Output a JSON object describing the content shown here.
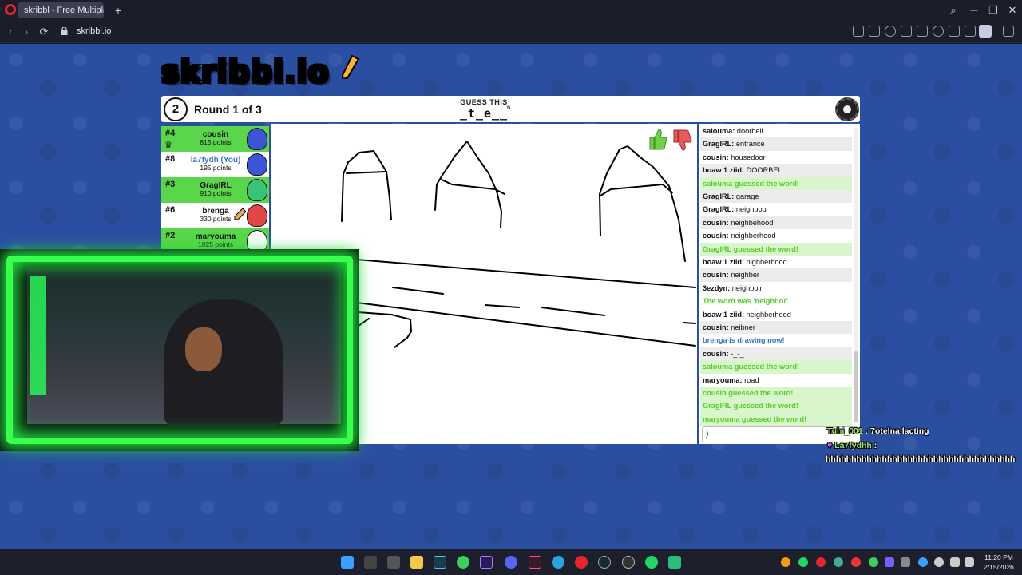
{
  "browser": {
    "tab_title": "skribbl - Free Multiplayer",
    "url": "skribbl.io",
    "new_tab": "+",
    "win_min": "─",
    "win_max": "❐",
    "win_close": "✕",
    "search_icon": "⌕",
    "back": "‹",
    "forward": "›",
    "reload": "⟳"
  },
  "game": {
    "logo": "skribbl.io",
    "round_number": "2",
    "round_text": "Round 1 of 3",
    "guess_label": "GUESS THIS",
    "hint": "_t_e__",
    "hint_count": "6"
  },
  "players": [
    {
      "rank": "#4",
      "name": "cousin",
      "points": "815 points",
      "bg": "#59d64a",
      "avatar_color": "#3b55d6",
      "crown": true
    },
    {
      "rank": "#8",
      "name": "la7fydh (You)",
      "points": "195 points",
      "bg": "#ffffff",
      "avatar_color": "#3b55d6",
      "you": true
    },
    {
      "rank": "#3",
      "name": "GragIRL",
      "points": "910 points",
      "bg": "#59d64a",
      "avatar_color": "#39c27a"
    },
    {
      "rank": "#6",
      "name": "brenga",
      "points": "330 points",
      "bg": "#ffffff",
      "avatar_color": "#e04646",
      "drawing": true
    },
    {
      "rank": "#2",
      "name": "maryouma",
      "points": "1025 points",
      "bg": "#59d64a",
      "avatar_color": "#ffffff"
    }
  ],
  "chat": [
    {
      "who": "salouma",
      "text": "doorbell",
      "style": "normal"
    },
    {
      "who": "GragIRL",
      "text": "entrance",
      "style": "alt"
    },
    {
      "who": "cousin",
      "text": "housedoor",
      "style": "normal"
    },
    {
      "who": "boaw 1 ziid",
      "text": "DOORBEL",
      "style": "alt"
    },
    {
      "who": "",
      "text": "salouma guessed the word!",
      "style": "green"
    },
    {
      "who": "GragIRL",
      "text": "garage",
      "style": "alt"
    },
    {
      "who": "GragIRL",
      "text": "neighbou",
      "style": "normal"
    },
    {
      "who": "cousin",
      "text": "neighbehood",
      "style": "alt"
    },
    {
      "who": "cousin",
      "text": "neighberhood",
      "style": "normal"
    },
    {
      "who": "",
      "text": "GragIRL guessed the word!",
      "style": "green"
    },
    {
      "who": "boaw 1 ziid",
      "text": "nighberhood",
      "style": "normal"
    },
    {
      "who": "cousin",
      "text": "neighber",
      "style": "alt"
    },
    {
      "who": "3ezdyn",
      "text": "neighboir",
      "style": "normal"
    },
    {
      "who": "",
      "text": "The word was 'neighbor'",
      "style": "greenplain"
    },
    {
      "who": "boaw 1 ziid",
      "text": "neighberhood",
      "style": "normal"
    },
    {
      "who": "cousin",
      "text": "neibner",
      "style": "alt"
    },
    {
      "who": "",
      "text": "brenga is drawing now!",
      "style": "blue"
    },
    {
      "who": "cousin",
      "text": "-_-_",
      "style": "alt"
    },
    {
      "who": "",
      "text": "salouma guessed the word!",
      "style": "green"
    },
    {
      "who": "maryouma",
      "text": "road",
      "style": "normal"
    },
    {
      "who": "",
      "text": "cousin guessed the word!",
      "style": "green"
    },
    {
      "who": "",
      "text": "GragIRL guessed the word!",
      "style": "green"
    },
    {
      "who": "",
      "text": "maryouma guessed the word!",
      "style": "green"
    }
  ],
  "chat_input_value": ")",
  "stream_chat": [
    {
      "who": "Tuhi_001",
      "text": ": 7otelna lacting"
    },
    {
      "who": "La7fydhh",
      "text": ":"
    },
    {
      "who": "",
      "text": "hhhhhhhhhhhhhhhhhhhhhhhhhhhhhhhhhhhhh"
    }
  ],
  "taskbar": {
    "time": "11:20 PM",
    "date": "2/15/2026"
  },
  "colors": {
    "page_bg": "#2b4fa0",
    "player_green": "#59d64a",
    "chat_green": "#56ce27",
    "chat_blue": "#3975ce",
    "cam_glow": "#39ff4d"
  }
}
